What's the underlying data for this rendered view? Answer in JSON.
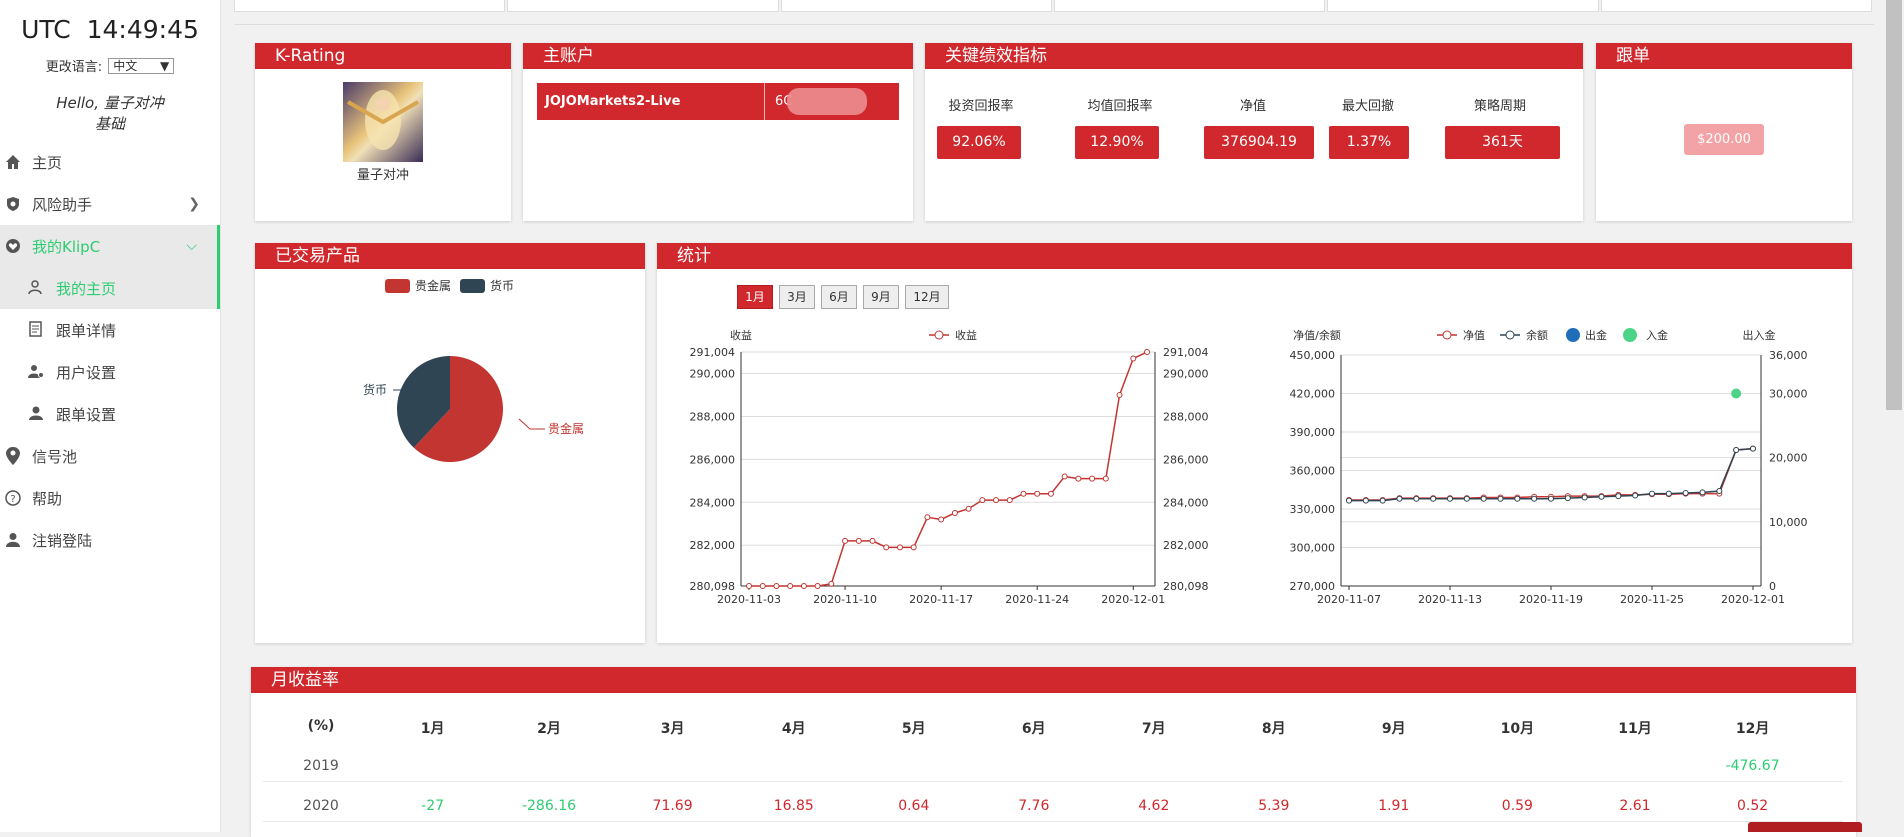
{
  "clock": {
    "tz": "UTC",
    "time": "14:49:45"
  },
  "lang": {
    "label": "更改语言:",
    "selected": "中文"
  },
  "user": {
    "hello": "Hello, 量子对冲",
    "level": "基础"
  },
  "nav": [
    {
      "label": "主页",
      "icon": "home-icon"
    },
    {
      "label": "风险助手",
      "icon": "shield-icon"
    },
    {
      "label": "我的KlipC",
      "icon": "heart-icon"
    }
  ],
  "subnav": [
    {
      "label": "我的主页",
      "icon": "user-outline-icon"
    },
    {
      "label": "跟单详情",
      "icon": "document-icon"
    },
    {
      "label": "用户设置",
      "icon": "user-settings-icon"
    },
    {
      "label": "跟单设置",
      "icon": "user-icon"
    }
  ],
  "nav2": [
    {
      "label": "信号池",
      "icon": "location-pin-icon"
    },
    {
      "label": "帮助",
      "icon": "help-icon"
    },
    {
      "label": "注销登陆",
      "icon": "person-icon"
    }
  ],
  "krating": {
    "title": "K-Rating",
    "name": "量子对冲"
  },
  "account": {
    "title": "主账户",
    "name": "JOJOMarkets2-Live",
    "number": "6C"
  },
  "kpi": {
    "title": "关键绩效指标",
    "labels": [
      "投资回报率",
      "均值回报率",
      "净值",
      "最大回撤",
      "策略周期"
    ],
    "values": [
      "92.06%",
      "12.90%",
      "376904.19",
      "1.37%",
      "361天"
    ]
  },
  "follow": {
    "title": "跟单",
    "amount": "$200.00"
  },
  "products": {
    "title": "已交易产品",
    "legend": [
      "贵金属",
      "货币"
    ],
    "labels": [
      "货币",
      "贵金属"
    ]
  },
  "stats": {
    "title": "统计",
    "tabs": [
      "1月",
      "3月",
      "6月",
      "9月",
      "12月"
    ],
    "left_ylabel": "收益",
    "left_legend": "收益",
    "left_yticks": [
      "291,004",
      "290,000",
      "288,000",
      "286,000",
      "284,000",
      "282,000",
      "280,098"
    ],
    "left_xticks": [
      "2020-11-03",
      "2020-11-10",
      "2020-11-17",
      "2020-11-24",
      "2020-12-01"
    ],
    "right_ylabel_left": "净值/余额",
    "right_ylabel_right": "出入金",
    "right_legend": [
      "净值",
      "余额",
      "出金",
      "入金"
    ],
    "right_yticks_left": [
      "450,000",
      "420,000",
      "390,000",
      "360,000",
      "330,000",
      "300,000",
      "270,000"
    ],
    "right_yticks_right": [
      "36,000",
      "30,000",
      "20,000",
      "10,000",
      "0"
    ],
    "right_xticks": [
      "2020-11-07",
      "2020-11-13",
      "2020-11-19",
      "2020-11-25",
      "2020-12-01"
    ]
  },
  "chart_data": [
    {
      "type": "pie",
      "categories": [
        "贵金属",
        "货币"
      ],
      "values": [
        62,
        38
      ],
      "colors": [
        "#c23531",
        "#2f4554"
      ]
    },
    {
      "type": "line",
      "ylabel": "收益",
      "ylim": [
        280098,
        291004
      ],
      "series": [
        {
          "name": "收益",
          "color": "#c23531",
          "values": [
            280100,
            280100,
            280100,
            280100,
            280100,
            280100,
            280200,
            282200,
            282200,
            282200,
            281900,
            281900,
            281900,
            283300,
            283200,
            283500,
            283700,
            284100,
            284100,
            284100,
            284400,
            284400,
            284400,
            285200,
            285100,
            285100,
            285100,
            289000,
            290700,
            291004
          ]
        }
      ]
    },
    {
      "type": "line",
      "ylabel": "净值/余额",
      "ylim": [
        270000,
        450000
      ],
      "series": [
        {
          "name": "净值",
          "color": "#c23531",
          "values": [
            337000,
            337000,
            337000,
            338500,
            338500,
            338500,
            338500,
            338500,
            339000,
            339000,
            339000,
            339500,
            339500,
            340000,
            340000,
            340000,
            341000,
            341000,
            341500,
            341500,
            342000,
            342000,
            342000,
            376000,
            377000
          ]
        },
        {
          "name": "余额",
          "color": "#2f4554",
          "values": [
            336500,
            336500,
            336500,
            338000,
            338000,
            338000,
            338000,
            338000,
            338000,
            338000,
            338000,
            338000,
            338000,
            338500,
            339000,
            339500,
            340000,
            340500,
            342000,
            342000,
            342500,
            343000,
            344000,
            376000,
            377000
          ]
        }
      ],
      "deposit": {
        "name": "入金",
        "value": 30000,
        "ylim": [
          0,
          36000
        ],
        "color": "#4cd486"
      }
    }
  ],
  "monthly": {
    "title": "月收益率",
    "headers": [
      "(%)",
      "1月",
      "2月",
      "3月",
      "4月",
      "5月",
      "6月",
      "7月",
      "8月",
      "9月",
      "10月",
      "11月",
      "12月"
    ],
    "rows": [
      {
        "year": "2019",
        "cells": [
          "",
          "",
          "",
          "",
          "",
          "",
          "",
          "",
          "",
          "",
          "",
          "-476.67"
        ]
      },
      {
        "year": "2020",
        "cells": [
          "-27",
          "-286.16",
          "71.69",
          "16.85",
          "0.64",
          "7.76",
          "4.62",
          "5.39",
          "1.91",
          "0.59",
          "2.61",
          "0.52"
        ]
      }
    ]
  }
}
